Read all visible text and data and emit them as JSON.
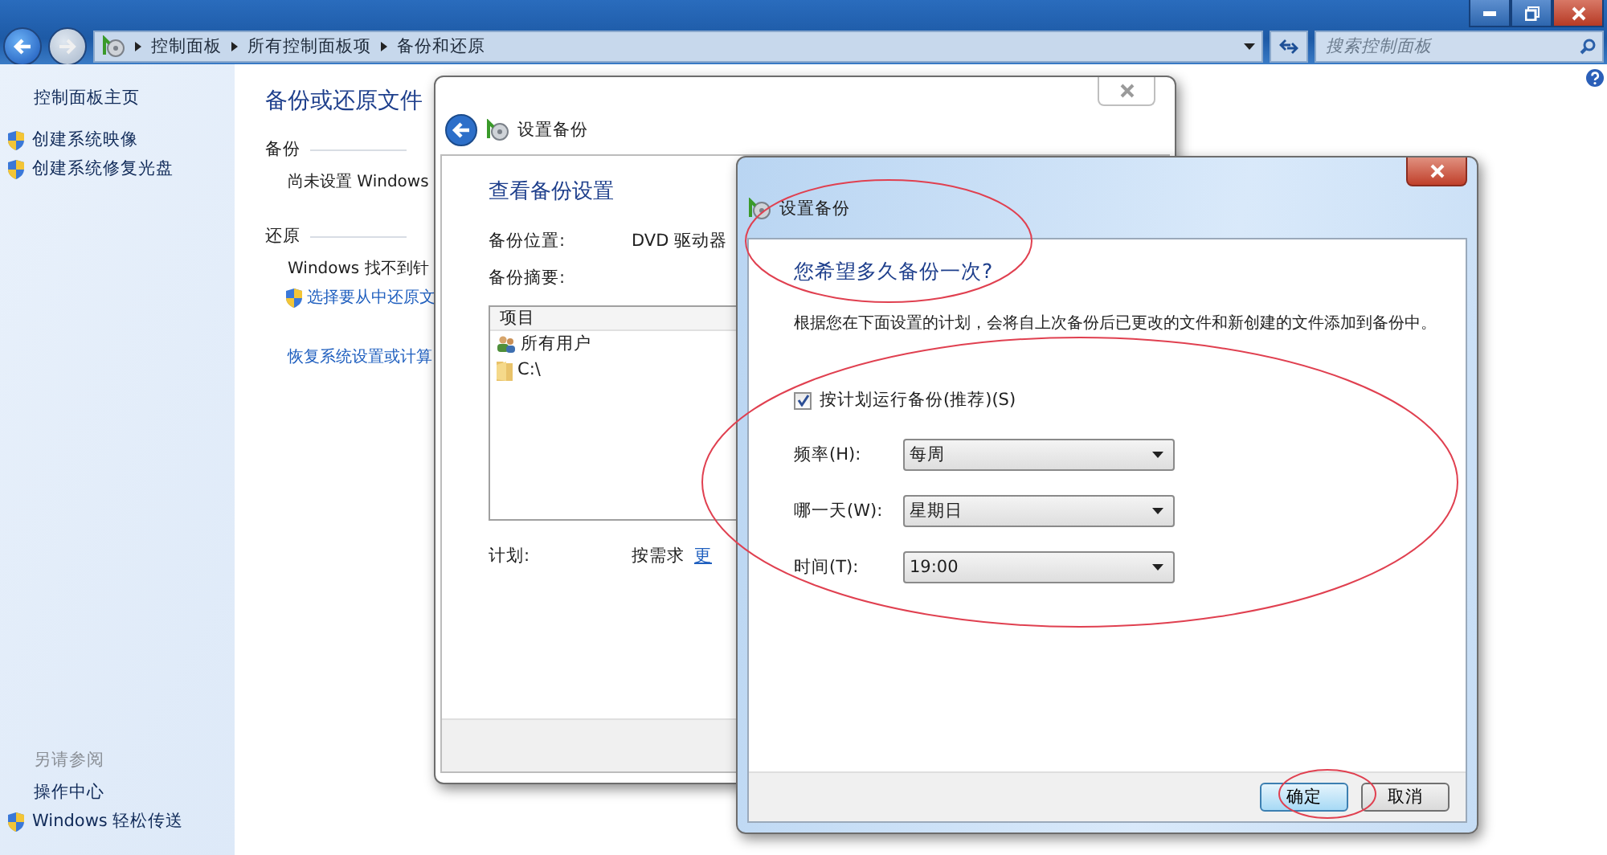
{
  "explorer": {
    "breadcrumb": [
      "控制面板",
      "所有控制面板项",
      "备份和还原"
    ],
    "search": {
      "placeholder": "搜索控制面板"
    }
  },
  "sidebar": {
    "top_links": [
      {
        "label": "控制面板主页",
        "shield": false
      },
      {
        "label": "创建系统映像",
        "shield": true
      },
      {
        "label": "创建系统修复光盘",
        "shield": true
      }
    ],
    "see_also_title": "另请参阅",
    "see_also_links": [
      {
        "label": "操作中心",
        "shield": false
      },
      {
        "label": "Windows 轻松传送",
        "shield": true
      }
    ]
  },
  "main": {
    "title": "备份或还原文件",
    "sections": [
      {
        "heading": "备份",
        "items": [
          {
            "kind": "text",
            "text": "尚未设置 Windows",
            "shield": false
          }
        ]
      },
      {
        "heading": "还原",
        "items": [
          {
            "kind": "text",
            "text": "Windows 找不到针",
            "shield": false
          },
          {
            "kind": "link",
            "text": "选择要从中还原文",
            "shield": true
          },
          {
            "kind": "gap"
          },
          {
            "kind": "link",
            "text": "恢复系统设置或计算",
            "shield": false
          }
        ]
      }
    ]
  },
  "dialog_back": {
    "title": "设置备份",
    "heading": "查看备份设置",
    "rows": [
      {
        "label": "备份位置:",
        "value": "DVD 驱动器"
      },
      {
        "label": "备份摘要:"
      }
    ],
    "list": {
      "column": "项目",
      "items": [
        {
          "kind": "users",
          "text": "所有用户"
        },
        {
          "kind": "folder",
          "text": "C:\\"
        }
      ]
    },
    "schedule": {
      "label": "计划:",
      "value": "按需求",
      "link": "更"
    }
  },
  "dialog_front": {
    "title": "设置备份",
    "heading": "您希望多久备份一次?",
    "description": "根据您在下面设置的计划，会将自上次备份后已更改的文件和新创建的文件添加到备份中。",
    "checkbox": {
      "label": "按计划运行备份(推荐)(S)",
      "checked": true
    },
    "fields": [
      {
        "label": "频率(H):",
        "value": "每周"
      },
      {
        "label": "哪一天(W):",
        "value": "星期日"
      },
      {
        "label": "时间(T):",
        "value": "19:00"
      }
    ],
    "buttons": [
      {
        "label": "确定",
        "default": true
      },
      {
        "label": "取消",
        "default": false
      }
    ]
  }
}
